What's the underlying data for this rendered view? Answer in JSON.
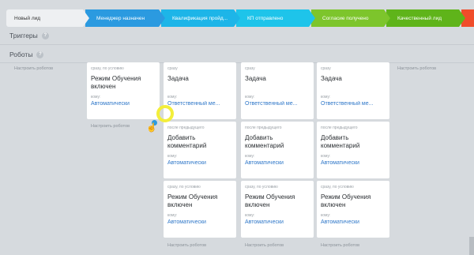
{
  "stages": [
    {
      "label": "Новый лид"
    },
    {
      "label": "Менеджер назначен"
    },
    {
      "label": "Квалификация пройд..."
    },
    {
      "label": "КП отправлено"
    },
    {
      "label": "Согласие получено"
    },
    {
      "label": "Качественный лид"
    },
    {
      "label": ""
    }
  ],
  "sections": {
    "triggers": "Триггеры",
    "robots": "Роботы",
    "help": "?"
  },
  "setup_label": "Настроить роботов",
  "cards": {
    "c0_r0": {
      "cond": "сразу, по условию",
      "name": "Режим Обучения включен",
      "who_lbl": "кому:",
      "who": "Автоматически"
    },
    "c1_r0": {
      "cond": "сразу",
      "name": "Задача",
      "who_lbl": "кому:",
      "who": "Ответственный ме..."
    },
    "c2_r0": {
      "cond": "сразу",
      "name": "Задача",
      "who_lbl": "кому:",
      "who": "Ответственный ме..."
    },
    "c3_r0": {
      "cond": "сразу",
      "name": "Задача",
      "who_lbl": "кому:",
      "who": "Ответственный ме..."
    },
    "c1_r1": {
      "cond": "после предыдущего",
      "name": "Добавить комментарий",
      "who_lbl": "кому:",
      "who": "Автоматически"
    },
    "c2_r1": {
      "cond": "после предыдущего",
      "name": "Добавить комментарий",
      "who_lbl": "кому:",
      "who": "Автоматически"
    },
    "c3_r1": {
      "cond": "после предыдущего",
      "name": "Добавить комментарий",
      "who_lbl": "кому:",
      "who": "Автоматически"
    },
    "c1_r2": {
      "cond": "сразу, по условию",
      "name": "Режим Обучения включен",
      "who_lbl": "кому:",
      "who": "Автоматически"
    },
    "c2_r2": {
      "cond": "сразу, по условию",
      "name": "Режим Обучения включен",
      "who_lbl": "кому:",
      "who": "Автоматически"
    },
    "c3_r2": {
      "cond": "сразу, по условию",
      "name": "Режим Обучения включен",
      "who_lbl": "кому:",
      "who": "Автоматически"
    }
  },
  "colors": {
    "stage_new": "#eef0f2",
    "stage_blue": "#2b9ae0",
    "stage_cyan": "#1ec4ea",
    "stage_green": "#7dc52c",
    "stage_red": "#f04d2a",
    "link": "#2d76c8",
    "cursor_highlight": "#f3ee3a"
  }
}
